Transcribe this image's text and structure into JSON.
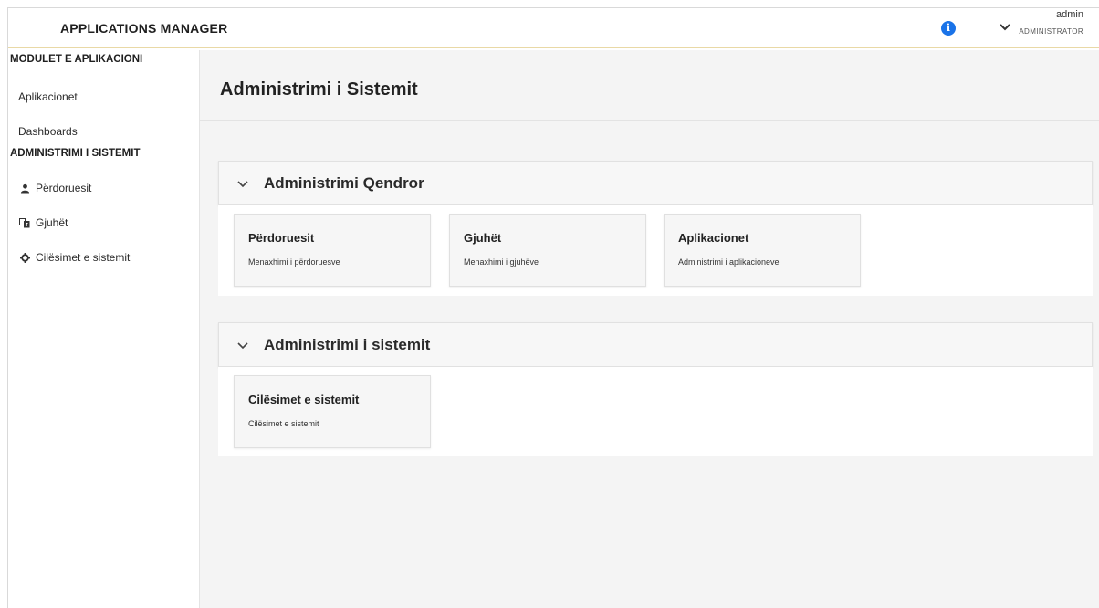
{
  "header": {
    "app_title": "APPLICATIONS MANAGER",
    "user_name": "admin",
    "user_role": "ADMINISTRATOR",
    "info_icon": "info-icon",
    "info_glyph": "i",
    "accent_color": "#1a73e8"
  },
  "sidebar": {
    "sections": [
      {
        "title": "MODULET E APLIKACIONI",
        "items": [
          {
            "label": "Aplikacionet",
            "icon": ""
          },
          {
            "label": "Dashboards",
            "icon": ""
          }
        ]
      },
      {
        "title": "ADMINISTRIMI I SISTEMIT",
        "items": [
          {
            "label": "Përdoruesit",
            "icon": "user-icon"
          },
          {
            "label": "Gjuhët",
            "icon": "language-icon"
          },
          {
            "label": "Cilësimet e sistemit",
            "icon": "gear-icon"
          }
        ]
      }
    ]
  },
  "main": {
    "page_title": "Administrimi i Sistemit",
    "panels": [
      {
        "title": "Administrimi Qendror",
        "expanded": true,
        "cards": [
          {
            "title": "Përdoruesit",
            "description": "Menaxhimi i përdoruesve"
          },
          {
            "title": "Gjuhët",
            "description": "Menaxhimi i gjuhëve"
          },
          {
            "title": "Aplikacionet",
            "description": "Administrimi i aplikacioneve"
          }
        ]
      },
      {
        "title": "Administrimi i sistemit",
        "expanded": true,
        "cards": [
          {
            "title": "Cilësimet e sistemit",
            "description": "Cilësimet e sistemit"
          }
        ]
      }
    ]
  }
}
